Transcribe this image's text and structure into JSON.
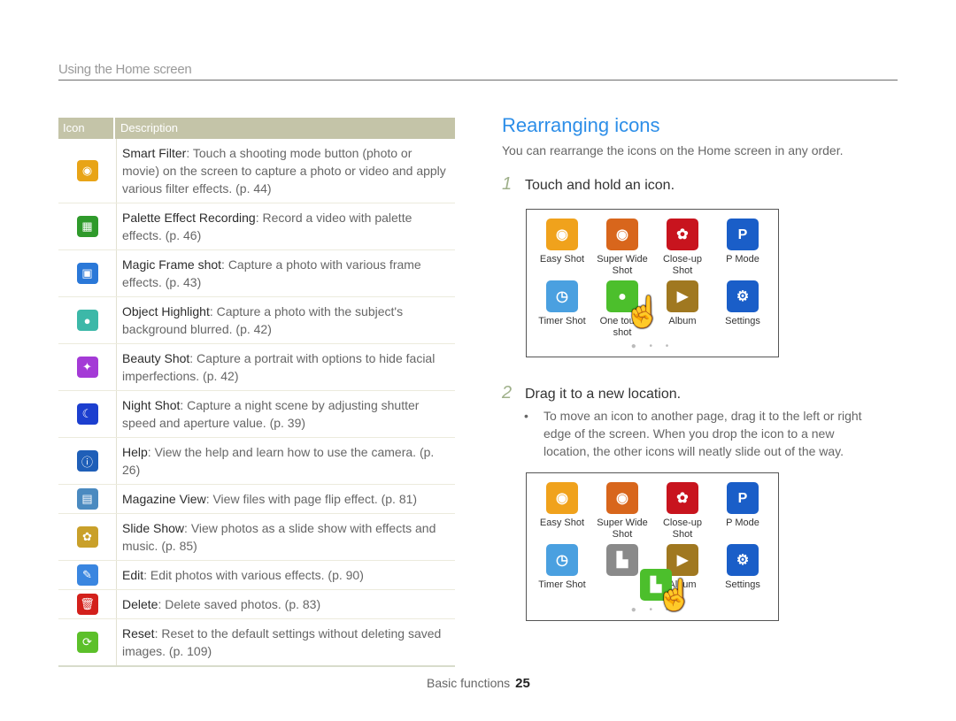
{
  "section_title": "Using the Home screen",
  "table": {
    "headers": {
      "icon": "Icon",
      "description": "Description"
    },
    "rows": [
      {
        "icon": "smart-filter-icon",
        "color": "#e8a417",
        "glyph": "◉",
        "title": "Smart Filter",
        "text": ": Touch a shooting mode button (photo or movie) on the screen to capture a photo or video and apply various filter effects. (p. 44)"
      },
      {
        "icon": "palette-effect-recording-icon",
        "color": "#2f9a2b",
        "glyph": "▦",
        "title": "Palette Effect Recording",
        "text": ": Record a video with palette effects. (p. 46)"
      },
      {
        "icon": "magic-frame-icon",
        "color": "#2a78d8",
        "glyph": "▣",
        "title": "Magic Frame shot",
        "text": ": Capture a photo with various frame effects. (p. 43)"
      },
      {
        "icon": "object-highlight-icon",
        "color": "#3cb8a8",
        "glyph": "●",
        "title": "Object Highlight",
        "text": ": Capture a photo with the subject's background blurred. (p. 42)"
      },
      {
        "icon": "beauty-shot-icon",
        "color": "#a43ad6",
        "glyph": "✦",
        "title": "Beauty Shot",
        "text": ": Capture a portrait with options to hide facial imperfections. (p. 42)"
      },
      {
        "icon": "night-shot-icon",
        "color": "#1c3fcf",
        "glyph": "☾",
        "title": "Night Shot",
        "text": ": Capture a night scene by adjusting shutter speed and aperture value. (p. 39)"
      },
      {
        "icon": "help-guide-book-icon",
        "color": "#1f5fb8",
        "glyph": "ⓘ",
        "title": "Help",
        "text": ": View the help and learn how to use the camera. (p. 26)"
      },
      {
        "icon": "magazine-view-icon",
        "color": "#4a8ac0",
        "glyph": "▤",
        "title": "Magazine View",
        "text": ": View files with page flip effect. (p. 81)"
      },
      {
        "icon": "slide-show-icon",
        "color": "#c9a02a",
        "glyph": "✿",
        "title": "Slide Show",
        "text": ": View photos as a slide show with effects and music. (p. 85)"
      },
      {
        "icon": "edit-icon",
        "color": "#3a86e0",
        "glyph": "✎",
        "title": "Edit",
        "text": ": Edit photos with various effects. (p. 90)"
      },
      {
        "icon": "delete-trash-icon",
        "color": "#d3201b",
        "glyph": "🗑",
        "title": "Delete",
        "text": ": Delete saved photos. (p. 83)"
      },
      {
        "icon": "reset-icon",
        "color": "#5cc02a",
        "glyph": "⟳",
        "title": "Reset",
        "text": ": Reset to the default settings without deleting saved images. (p. 109)"
      }
    ]
  },
  "rearranging": {
    "title": "Rearranging icons",
    "intro": "You can rearrange the icons on the Home screen in any order.",
    "step1": {
      "num": "1",
      "text": "Touch and hold an icon."
    },
    "step2": {
      "num": "2",
      "text": "Drag it to a new location."
    },
    "bullet": "To move an icon to another page, drag it to the left or right edge of the screen. When you drop the icon to a new location, the other icons will neatly slide out of the way.",
    "bullet_mark": "•"
  },
  "screen1": {
    "apps": [
      {
        "label": "Easy Shot",
        "color": "#f0a21c",
        "glyph": "◉"
      },
      {
        "label": "Super Wide Shot",
        "color": "#d8661c",
        "glyph": "◉"
      },
      {
        "label": "Close-up Shot",
        "color": "#c8141e",
        "glyph": "✿"
      },
      {
        "label": "P Mode",
        "color": "#1a5ec8",
        "glyph": "P"
      },
      {
        "label": "Timer Shot",
        "color": "#4aa0e0",
        "glyph": "◷"
      },
      {
        "label": "One touch shot",
        "color": "#4cbf2c",
        "glyph": "●"
      },
      {
        "label": "Album",
        "color": "#a07820",
        "glyph": "▶"
      },
      {
        "label": "Settings",
        "color": "#1a5ec8",
        "glyph": "⚙"
      }
    ],
    "page_dots": "● • •",
    "hand": "☝"
  },
  "screen2": {
    "apps": [
      {
        "label": "Easy Shot",
        "color": "#f0a21c",
        "glyph": "◉"
      },
      {
        "label": "Super Wide Shot",
        "color": "#d8661c",
        "glyph": "◉"
      },
      {
        "label": "Close-up Shot",
        "color": "#c8141e",
        "glyph": "✿"
      },
      {
        "label": "P Mode",
        "color": "#1a5ec8",
        "glyph": "P"
      },
      {
        "label": "Timer Shot",
        "color": "#4aa0e0",
        "glyph": "◷"
      },
      {
        "label": "",
        "color": "#8a8a8a",
        "glyph": "▙"
      },
      {
        "label": "Album",
        "color": "#a07820",
        "glyph": "▶"
      },
      {
        "label": "Settings",
        "color": "#1a5ec8",
        "glyph": "⚙"
      }
    ],
    "dragged": {
      "color": "#4cbf2c",
      "glyph": "▙"
    },
    "page_dots": "● • •",
    "hand": "☝"
  },
  "footer": {
    "label": "Basic functions",
    "page": "25"
  }
}
